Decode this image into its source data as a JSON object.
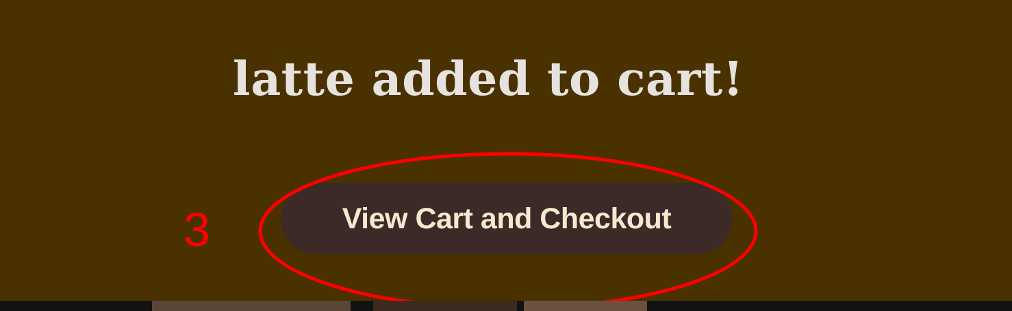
{
  "banner": {
    "message": "latte added to cart!",
    "button_label": "View Cart and Checkout"
  },
  "annotation": {
    "label": "3",
    "color": "#ff0000"
  },
  "colors": {
    "banner_bg": "#4a3100",
    "button_bg": "#3c2a28",
    "button_text": "#f6e9cf",
    "headline_text": "#e6e3de"
  }
}
